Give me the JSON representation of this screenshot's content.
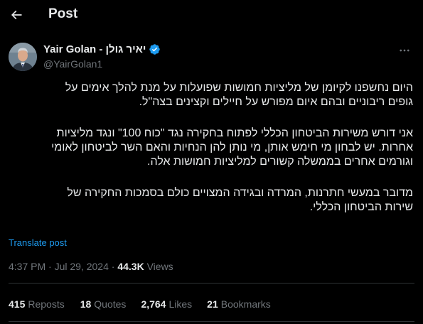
{
  "header": {
    "title": "Post",
    "back_icon": "arrow-left-icon"
  },
  "author": {
    "name": "Yair Golan - יאיר גולן",
    "handle": "@YairGolan1",
    "verified": true,
    "verified_color": "#1d9bf0"
  },
  "tweet": {
    "paragraphs": [
      "היום נחשפנו לקיומן של מליציות חמושות שפועלות על מנת להלך אימים על\nגופים ריבוניים ובהם איום מפורש על חיילים וקצינים בצה\"ל.",
      "אני דורש משירות הביטחון הכללי לפתוח בחקירה נגד \"כוח 100\" ונגד מליציות\nאחרות. יש לבחון מי חימש אותן, מי נותן להן הנחיות והאם השר לביטחון לאומי\nוגורמים אחרים בממשלה קשורים למליציות חמושות אלה.",
      "מדובר במעשי חתרנות, המרדה ובגידה המצויים כולם בסמכות החקירה של\nשירות הביטחון הכללי."
    ],
    "translate_label": "Translate post"
  },
  "meta": {
    "time": "4:37 PM",
    "separator": "·",
    "date": "Jul 29, 2024",
    "views_count": "44.3K",
    "views_label": "Views"
  },
  "stats": {
    "reposts": {
      "count": "415",
      "label": "Reposts"
    },
    "quotes": {
      "count": "18",
      "label": "Quotes"
    },
    "likes": {
      "count": "2,764",
      "label": "Likes"
    },
    "bookmarks": {
      "count": "21",
      "label": "Bookmarks"
    }
  },
  "colors": {
    "background": "#000000",
    "text": "#e7e9ea",
    "secondary": "#71767b",
    "accent": "#1d9bf0",
    "divider": "#2f3336"
  }
}
